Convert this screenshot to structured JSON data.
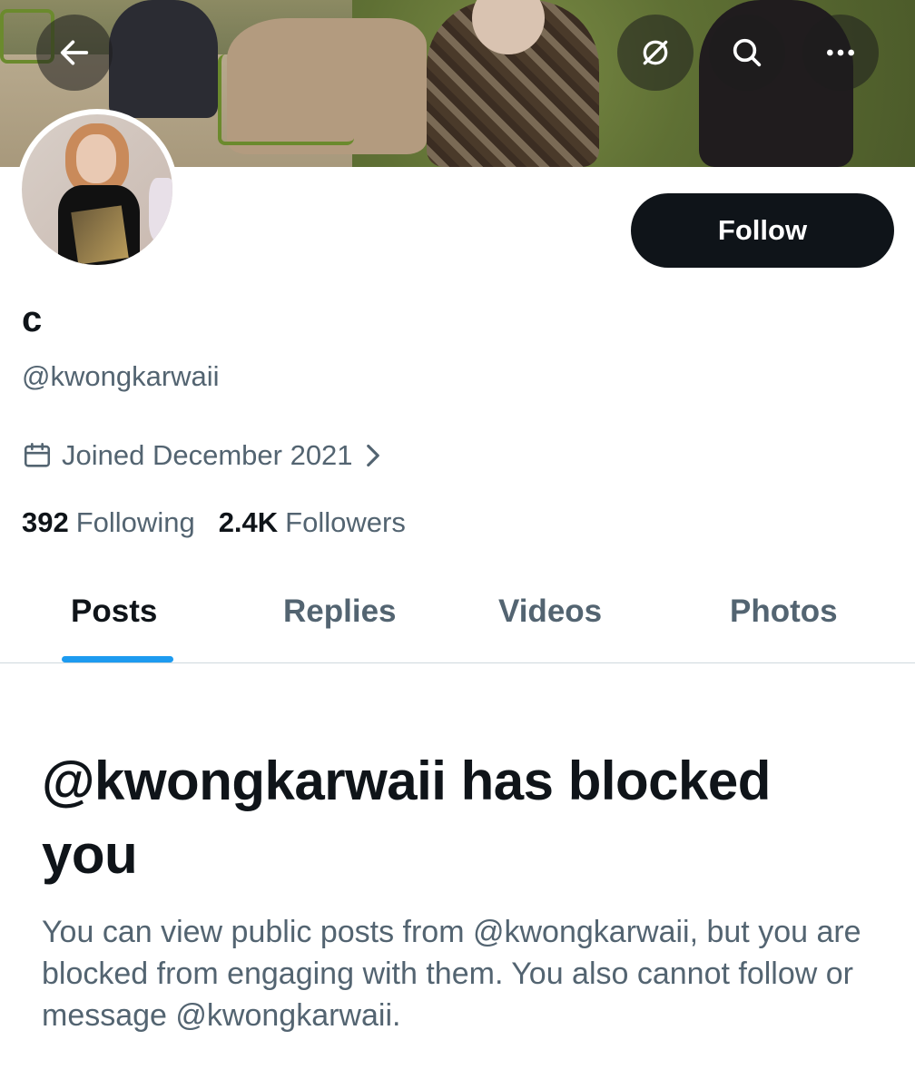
{
  "header": {
    "back_icon": "arrow-left-icon",
    "icons": [
      "unfollow-slash-icon",
      "search-icon",
      "more-icon"
    ]
  },
  "profile": {
    "name": "c",
    "handle": "@kwongkarwaii",
    "follow_label": "Follow",
    "joined": "Joined December 2021",
    "following_count": "392",
    "following_label": "Following",
    "followers_count": "2.4K",
    "followers_label": "Followers"
  },
  "tabs": [
    {
      "label": "Posts",
      "active": true
    },
    {
      "label": "Replies",
      "active": false
    },
    {
      "label": "Videos",
      "active": false
    },
    {
      "label": "Photos",
      "active": false
    }
  ],
  "blocked": {
    "title": "@kwongkarwaii has blocked you",
    "description": "You can view public posts from @kwongkarwaii, but you are blocked from engaging with them. You also cannot follow or message @kwongkarwaii."
  },
  "colors": {
    "accent": "#1d9bf0",
    "text_primary": "#0f1419",
    "text_secondary": "#536471",
    "button_bg": "#0f1419"
  }
}
